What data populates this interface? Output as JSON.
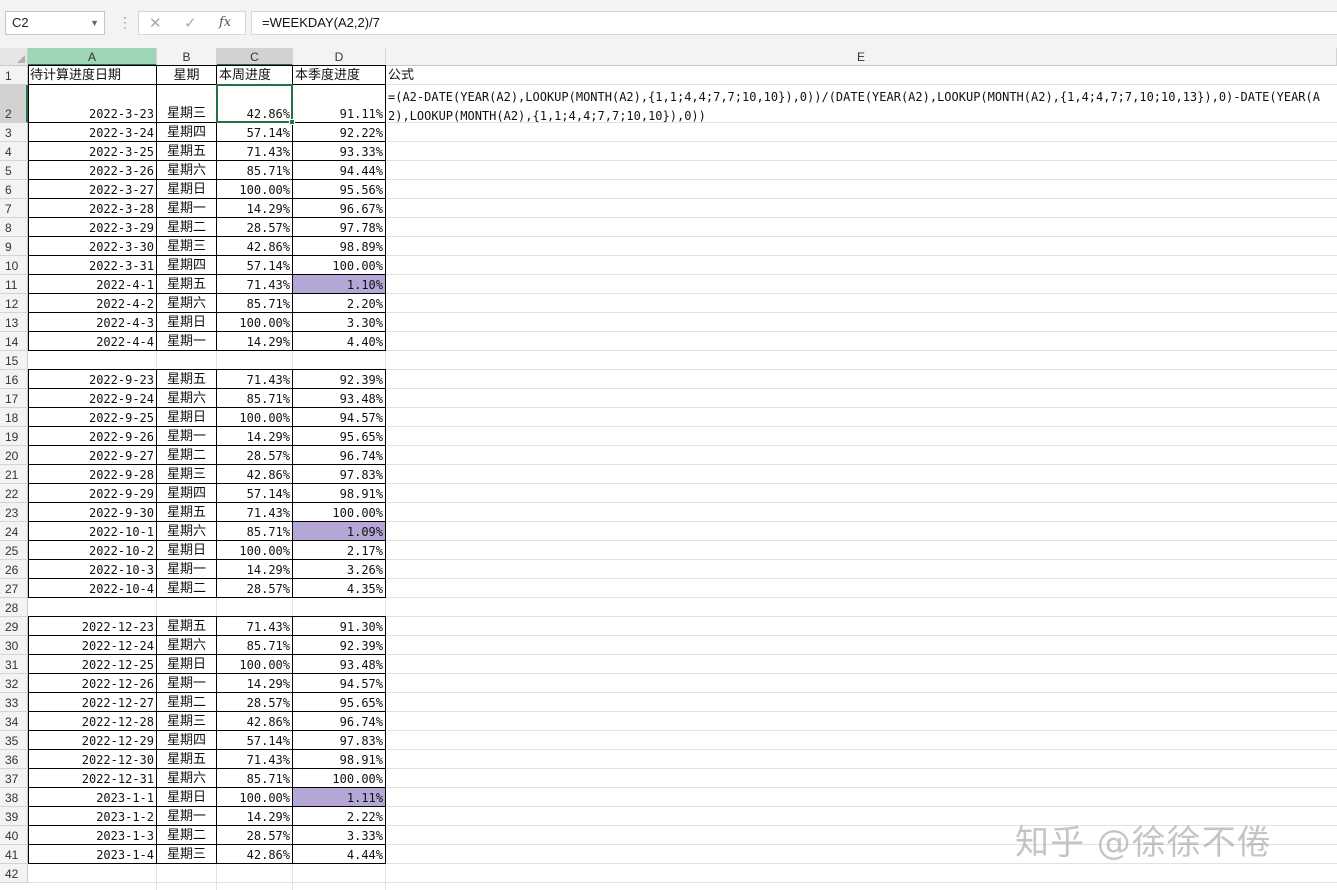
{
  "formula_bar": {
    "name_box": "C2",
    "cancel_icon": "✕",
    "enter_icon": "✓",
    "fx_label": "fx",
    "formula": "=WEEKDAY(A2,2)/7"
  },
  "columns": [
    "A",
    "B",
    "C",
    "D",
    "E"
  ],
  "rows": [
    {
      "n": "1",
      "a": "待计算进度日期",
      "b": "星期",
      "c": "本周进度",
      "d": "本季度进度",
      "e": "公式"
    },
    {
      "n": "2",
      "a": "2022-3-23",
      "b": "星期三",
      "c": "42.86%",
      "d": "91.11%"
    },
    {
      "n": "3",
      "a": "2022-3-24",
      "b": "星期四",
      "c": "57.14%",
      "d": "92.22%"
    },
    {
      "n": "4",
      "a": "2022-3-25",
      "b": "星期五",
      "c": "71.43%",
      "d": "93.33%"
    },
    {
      "n": "5",
      "a": "2022-3-26",
      "b": "星期六",
      "c": "85.71%",
      "d": "94.44%"
    },
    {
      "n": "6",
      "a": "2022-3-27",
      "b": "星期日",
      "c": "100.00%",
      "d": "95.56%"
    },
    {
      "n": "7",
      "a": "2022-3-28",
      "b": "星期一",
      "c": "14.29%",
      "d": "96.67%"
    },
    {
      "n": "8",
      "a": "2022-3-29",
      "b": "星期二",
      "c": "28.57%",
      "d": "97.78%"
    },
    {
      "n": "9",
      "a": "2022-3-30",
      "b": "星期三",
      "c": "42.86%",
      "d": "98.89%"
    },
    {
      "n": "10",
      "a": "2022-3-31",
      "b": "星期四",
      "c": "57.14%",
      "d": "100.00%"
    },
    {
      "n": "11",
      "a": "2022-4-1",
      "b": "星期五",
      "c": "71.43%",
      "d": "1.10%",
      "hl": true
    },
    {
      "n": "12",
      "a": "2022-4-2",
      "b": "星期六",
      "c": "85.71%",
      "d": "2.20%"
    },
    {
      "n": "13",
      "a": "2022-4-3",
      "b": "星期日",
      "c": "100.00%",
      "d": "3.30%"
    },
    {
      "n": "14",
      "a": "2022-4-4",
      "b": "星期一",
      "c": "14.29%",
      "d": "4.40%"
    },
    {
      "n": "15",
      "blank": true
    },
    {
      "n": "16",
      "a": "2022-9-23",
      "b": "星期五",
      "c": "71.43%",
      "d": "92.39%"
    },
    {
      "n": "17",
      "a": "2022-9-24",
      "b": "星期六",
      "c": "85.71%",
      "d": "93.48%"
    },
    {
      "n": "18",
      "a": "2022-9-25",
      "b": "星期日",
      "c": "100.00%",
      "d": "94.57%"
    },
    {
      "n": "19",
      "a": "2022-9-26",
      "b": "星期一",
      "c": "14.29%",
      "d": "95.65%"
    },
    {
      "n": "20",
      "a": "2022-9-27",
      "b": "星期二",
      "c": "28.57%",
      "d": "96.74%"
    },
    {
      "n": "21",
      "a": "2022-9-28",
      "b": "星期三",
      "c": "42.86%",
      "d": "97.83%"
    },
    {
      "n": "22",
      "a": "2022-9-29",
      "b": "星期四",
      "c": "57.14%",
      "d": "98.91%"
    },
    {
      "n": "23",
      "a": "2022-9-30",
      "b": "星期五",
      "c": "71.43%",
      "d": "100.00%"
    },
    {
      "n": "24",
      "a": "2022-10-1",
      "b": "星期六",
      "c": "85.71%",
      "d": "1.09%",
      "hl": true
    },
    {
      "n": "25",
      "a": "2022-10-2",
      "b": "星期日",
      "c": "100.00%",
      "d": "2.17%"
    },
    {
      "n": "26",
      "a": "2022-10-3",
      "b": "星期一",
      "c": "14.29%",
      "d": "3.26%"
    },
    {
      "n": "27",
      "a": "2022-10-4",
      "b": "星期二",
      "c": "28.57%",
      "d": "4.35%"
    },
    {
      "n": "28",
      "blank": true
    },
    {
      "n": "29",
      "a": "2022-12-23",
      "b": "星期五",
      "c": "71.43%",
      "d": "91.30%"
    },
    {
      "n": "30",
      "a": "2022-12-24",
      "b": "星期六",
      "c": "85.71%",
      "d": "92.39%"
    },
    {
      "n": "31",
      "a": "2022-12-25",
      "b": "星期日",
      "c": "100.00%",
      "d": "93.48%"
    },
    {
      "n": "32",
      "a": "2022-12-26",
      "b": "星期一",
      "c": "14.29%",
      "d": "94.57%"
    },
    {
      "n": "33",
      "a": "2022-12-27",
      "b": "星期二",
      "c": "28.57%",
      "d": "95.65%"
    },
    {
      "n": "34",
      "a": "2022-12-28",
      "b": "星期三",
      "c": "42.86%",
      "d": "96.74%"
    },
    {
      "n": "35",
      "a": "2022-12-29",
      "b": "星期四",
      "c": "57.14%",
      "d": "97.83%"
    },
    {
      "n": "36",
      "a": "2022-12-30",
      "b": "星期五",
      "c": "71.43%",
      "d": "98.91%"
    },
    {
      "n": "37",
      "a": "2022-12-31",
      "b": "星期六",
      "c": "85.71%",
      "d": "100.00%"
    },
    {
      "n": "38",
      "a": "2023-1-1",
      "b": "星期日",
      "c": "100.00%",
      "d": "1.11%",
      "hl": true
    },
    {
      "n": "39",
      "a": "2023-1-2",
      "b": "星期一",
      "c": "14.29%",
      "d": "2.22%"
    },
    {
      "n": "40",
      "a": "2023-1-3",
      "b": "星期二",
      "c": "28.57%",
      "d": "3.33%"
    },
    {
      "n": "41",
      "a": "2023-1-4",
      "b": "星期三",
      "c": "42.86%",
      "d": "4.44%"
    },
    {
      "n": "42",
      "blank": true
    }
  ],
  "e2_formula": "=(A2-DATE(YEAR(A2),LOOKUP(MONTH(A2),{1,1;4,4;7,7;10,10}),0))/(DATE(YEAR(A2),LOOKUP(MONTH(A2),{1,4;4,7;7,10;10,13}),0)-DATE(YEAR(A2),LOOKUP(MONTH(A2),{1,1;4,4;7,7;10,10}),0))",
  "watermark": "知乎 @徐徐不倦",
  "colors": {
    "highlight": "#b4a7d6",
    "selection": "#217346"
  }
}
